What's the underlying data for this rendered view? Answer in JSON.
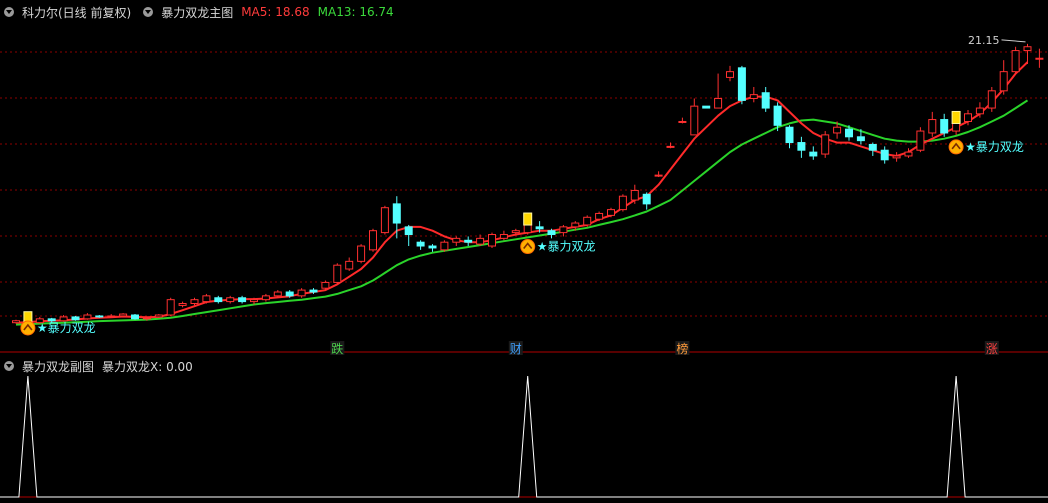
{
  "header": {
    "instrument": "科力尔(日线 前复权)",
    "indicator": "暴力双龙主图",
    "ma5_label": "MA5: 18.68",
    "ma13_label": "MA13: 16.74"
  },
  "subheader": {
    "indicator": "暴力双龙副图",
    "value_label": "暴力双龙X: 0.00"
  },
  "colors": {
    "up": "#ff3030",
    "down": "#54ffff",
    "ma5": "#ff2a2a",
    "ma13": "#2ad32a",
    "grid": "#8b0000",
    "separator": "#b00000",
    "marker_text": "#54ffff"
  },
  "chart_data": [
    {
      "type": "candlestick",
      "title": "暴力双龙主图",
      "ylim": [
        5.8,
        22.5
      ],
      "max_label": "21.15",
      "candles": [
        [
          6.6,
          6.7,
          6.75,
          6.55
        ],
        [
          6.65,
          6.55,
          6.72,
          6.5
        ],
        [
          6.6,
          6.8,
          6.9,
          6.55
        ],
        [
          6.8,
          6.7,
          6.85,
          6.6
        ],
        [
          6.7,
          6.9,
          7.0,
          6.65
        ],
        [
          6.9,
          6.75,
          6.95,
          6.7
        ],
        [
          6.8,
          7.0,
          7.1,
          6.75
        ],
        [
          6.95,
          6.9,
          7.0,
          6.85
        ],
        [
          6.95,
          6.95,
          7.05,
          6.9
        ],
        [
          6.95,
          7.05,
          7.1,
          6.9
        ],
        [
          7.0,
          6.8,
          7.05,
          6.75
        ],
        [
          6.8,
          6.85,
          6.9,
          6.7
        ],
        [
          6.9,
          7.0,
          7.05,
          6.85
        ],
        [
          7.0,
          7.8,
          7.9,
          6.95
        ],
        [
          7.5,
          7.6,
          7.7,
          7.4
        ],
        [
          7.6,
          7.8,
          7.9,
          7.5
        ],
        [
          7.7,
          8.0,
          8.1,
          7.6
        ],
        [
          7.9,
          7.7,
          8.0,
          7.6
        ],
        [
          7.7,
          7.9,
          8.0,
          7.6
        ],
        [
          7.9,
          7.7,
          8.0,
          7.6
        ],
        [
          7.7,
          7.8,
          7.9,
          7.55
        ],
        [
          7.8,
          8.0,
          8.1,
          7.7
        ],
        [
          8.0,
          8.2,
          8.3,
          7.9
        ],
        [
          8.2,
          8.0,
          8.3,
          7.9
        ],
        [
          8.0,
          8.3,
          8.4,
          7.9
        ],
        [
          8.3,
          8.2,
          8.4,
          8.1
        ],
        [
          8.4,
          8.7,
          8.8,
          8.3
        ],
        [
          8.7,
          9.6,
          9.7,
          8.6
        ],
        [
          9.4,
          9.8,
          10.0,
          9.3
        ],
        [
          9.8,
          10.6,
          10.7,
          9.7
        ],
        [
          10.4,
          11.4,
          11.5,
          10.3
        ],
        [
          11.3,
          12.6,
          12.7,
          11.2
        ],
        [
          12.8,
          11.8,
          13.2,
          11.0
        ],
        [
          11.6,
          11.2,
          11.7,
          10.6
        ],
        [
          10.8,
          10.6,
          10.9,
          10.4
        ],
        [
          10.6,
          10.5,
          10.7,
          10.3
        ],
        [
          10.4,
          10.8,
          10.9,
          10.3
        ],
        [
          10.8,
          11.0,
          11.1,
          10.6
        ],
        [
          10.9,
          10.8,
          11.1,
          10.6
        ],
        [
          10.7,
          11.0,
          11.2,
          10.6
        ],
        [
          10.6,
          11.2,
          11.3,
          10.5
        ],
        [
          11.0,
          11.2,
          11.4,
          10.9
        ],
        [
          11.3,
          11.4,
          11.5,
          11.2
        ],
        [
          11.3,
          11.8,
          11.9,
          11.2
        ],
        [
          11.6,
          11.5,
          11.9,
          11.3
        ],
        [
          11.4,
          11.2,
          11.5,
          11.0
        ],
        [
          11.3,
          11.6,
          11.7,
          11.1
        ],
        [
          11.6,
          11.8,
          11.9,
          11.4
        ],
        [
          11.7,
          12.1,
          12.2,
          11.6
        ],
        [
          12.0,
          12.3,
          12.4,
          11.9
        ],
        [
          12.2,
          12.5,
          12.6,
          12.1
        ],
        [
          12.5,
          13.2,
          13.3,
          12.4
        ],
        [
          13.0,
          13.5,
          13.8,
          12.8
        ],
        [
          13.3,
          12.8,
          13.4,
          12.5
        ],
        [
          14.3,
          14.3,
          14.5,
          14.2
        ],
        [
          15.8,
          15.8,
          16.0,
          15.7
        ],
        [
          17.1,
          17.1,
          17.3,
          17.0
        ],
        [
          16.4,
          17.9,
          18.3,
          16.4
        ],
        [
          17.9,
          17.8,
          17.9,
          17.8
        ],
        [
          17.8,
          18.3,
          19.6,
          17.8
        ],
        [
          19.4,
          19.7,
          20.0,
          19.2
        ],
        [
          19.9,
          18.2,
          20.0,
          18.0
        ],
        [
          18.3,
          18.5,
          18.9,
          18.1
        ],
        [
          18.6,
          17.8,
          18.9,
          17.6
        ],
        [
          17.9,
          16.9,
          18.1,
          16.6
        ],
        [
          16.8,
          16.0,
          16.9,
          15.7
        ],
        [
          16.0,
          15.6,
          16.3,
          15.2
        ],
        [
          15.5,
          15.3,
          15.8,
          15.1
        ],
        [
          15.4,
          16.4,
          16.6,
          15.2
        ],
        [
          16.5,
          16.8,
          17.1,
          16.2
        ],
        [
          16.7,
          16.3,
          16.9,
          16.1
        ],
        [
          16.3,
          16.1,
          16.7,
          15.9
        ],
        [
          15.9,
          15.6,
          16.0,
          15.3
        ],
        [
          15.6,
          15.1,
          15.8,
          14.9
        ],
        [
          15.2,
          15.3,
          15.5,
          15.0
        ],
        [
          15.3,
          15.5,
          15.7,
          15.2
        ],
        [
          15.6,
          16.6,
          16.8,
          15.5
        ],
        [
          16.5,
          17.2,
          17.6,
          16.3
        ],
        [
          17.2,
          16.5,
          17.5,
          16.3
        ],
        [
          16.6,
          17.1,
          17.3,
          16.4
        ],
        [
          17.1,
          17.5,
          17.7,
          16.9
        ],
        [
          17.5,
          17.8,
          18.1,
          17.3
        ],
        [
          17.8,
          18.7,
          18.9,
          17.6
        ],
        [
          18.7,
          19.7,
          20.3,
          18.5
        ],
        [
          19.7,
          20.8,
          21.0,
          19.6
        ],
        [
          20.8,
          21.0,
          21.15,
          20.1
        ],
        [
          20.4,
          20.4,
          20.9,
          19.9
        ]
      ],
      "series": [
        {
          "name": "MA5",
          "values": [
            6.6,
            6.63,
            6.67,
            6.7,
            6.72,
            6.77,
            6.82,
            6.86,
            6.88,
            6.92,
            6.9,
            6.88,
            6.9,
            7.05,
            7.25,
            7.46,
            7.68,
            7.75,
            7.8,
            7.83,
            7.83,
            7.86,
            7.92,
            7.98,
            8.1,
            8.2,
            8.3,
            8.6,
            9.0,
            9.4,
            10.0,
            10.8,
            11.4,
            11.6,
            11.6,
            11.4,
            11.1,
            10.9,
            10.8,
            10.8,
            10.9,
            11.05,
            11.2,
            11.3,
            11.4,
            11.4,
            11.5,
            11.6,
            11.7,
            12.0,
            12.2,
            12.6,
            13.0,
            13.2,
            13.8,
            14.6,
            15.4,
            16.2,
            16.8,
            17.4,
            17.9,
            18.2,
            18.4,
            18.4,
            18.2,
            17.6,
            17.0,
            16.5,
            16.2,
            16.0,
            16.0,
            15.8,
            15.6,
            15.4,
            15.3,
            15.5,
            15.9,
            16.2,
            16.5,
            16.8,
            17.1,
            17.5,
            18.1,
            18.8,
            19.6,
            20.2
          ]
        },
        {
          "name": "MA13",
          "values": [
            6.5,
            6.52,
            6.55,
            6.58,
            6.6,
            6.62,
            6.65,
            6.68,
            6.7,
            6.72,
            6.74,
            6.76,
            6.8,
            6.86,
            6.95,
            7.05,
            7.15,
            7.25,
            7.35,
            7.45,
            7.55,
            7.62,
            7.68,
            7.74,
            7.8,
            7.88,
            7.96,
            8.1,
            8.3,
            8.5,
            8.8,
            9.2,
            9.6,
            9.9,
            10.1,
            10.25,
            10.35,
            10.45,
            10.55,
            10.65,
            10.75,
            10.85,
            10.95,
            11.05,
            11.15,
            11.25,
            11.35,
            11.45,
            11.55,
            11.7,
            11.85,
            12.0,
            12.2,
            12.4,
            12.7,
            13.0,
            13.5,
            14.0,
            14.5,
            15.0,
            15.5,
            15.9,
            16.2,
            16.5,
            16.8,
            17.0,
            17.15,
            17.2,
            17.1,
            17.0,
            16.8,
            16.6,
            16.4,
            16.2,
            16.1,
            16.05,
            16.05,
            16.1,
            16.2,
            16.35,
            16.55,
            16.8,
            17.1,
            17.4,
            17.8,
            18.2
          ]
        }
      ],
      "signals": [
        {
          "index": 1,
          "label": "暴力双龙"
        },
        {
          "index": 43,
          "label": "暴力双龙"
        },
        {
          "index": 79,
          "label": "暴力双龙"
        }
      ],
      "bottom_tags": [
        {
          "index": 27,
          "label": "跌"
        },
        {
          "index": 42,
          "label": "财"
        },
        {
          "index": 56,
          "label": "榜"
        },
        {
          "index": 82,
          "label": "涨"
        }
      ]
    },
    {
      "type": "line",
      "title": "暴力双龙副图",
      "ylim": [
        0,
        1
      ],
      "series": [
        {
          "name": "暴力双龙X",
          "peaks_at": [
            1,
            43,
            79
          ],
          "peak_value": 1,
          "base_value": 0
        }
      ]
    }
  ]
}
